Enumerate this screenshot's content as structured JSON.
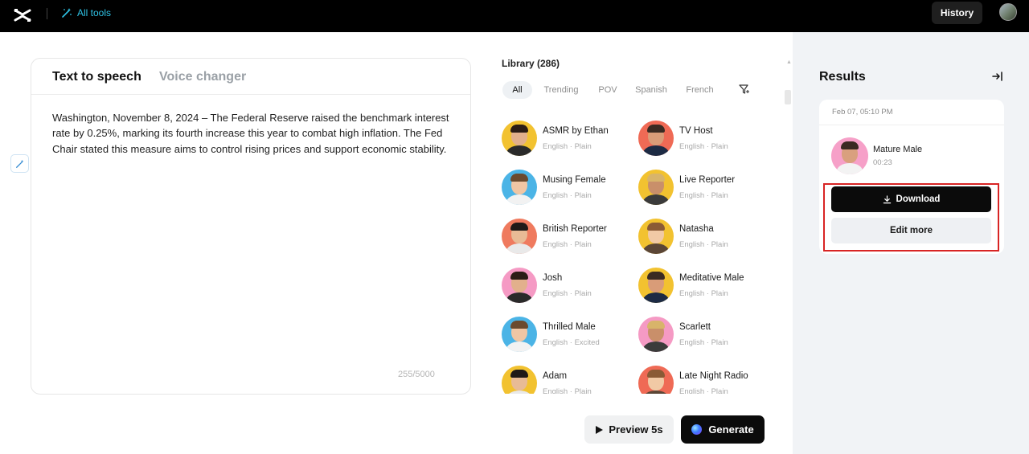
{
  "header": {
    "all_tools_label": "All tools",
    "history_label": "History",
    "icons": [
      "capcut-logo-icon",
      "magic-wand-icon",
      "user-avatar"
    ]
  },
  "editor": {
    "tabs": [
      {
        "label": "Text to speech",
        "active": true
      },
      {
        "label": "Voice changer",
        "active": false
      }
    ],
    "text": "Washington, November 8, 2024 – The Federal Reserve raised the benchmark interest rate by 0.25%, marking its fourth increase this year to combat high inflation. The Fed Chair stated this measure aims to control rising prices and support economic stability.",
    "char_count": "255/5000"
  },
  "library": {
    "title": "Library (286)",
    "filters": [
      {
        "label": "All",
        "active": true
      },
      {
        "label": "Trending",
        "active": false
      },
      {
        "label": "POV",
        "active": false
      },
      {
        "label": "Spanish",
        "active": false
      },
      {
        "label": "French",
        "active": false
      }
    ],
    "voices": [
      {
        "name": "ASMR by Ethan",
        "meta": "English · Plain",
        "bg": "#f2c230"
      },
      {
        "name": "TV Host",
        "meta": "English · Plain",
        "bg": "#ef6a55"
      },
      {
        "name": "Musing Female",
        "meta": "English · Plain",
        "bg": "#4bb4e6"
      },
      {
        "name": "Live Reporter",
        "meta": "English · Plain",
        "bg": "#f2c230"
      },
      {
        "name": "British Reporter",
        "meta": "English · Plain",
        "bg": "#ef7a5e"
      },
      {
        "name": "Natasha",
        "meta": "English · Plain",
        "bg": "#f2c230"
      },
      {
        "name": "Josh",
        "meta": "English · Plain",
        "bg": "#f59ac4"
      },
      {
        "name": "Meditative Male",
        "meta": "English · Plain",
        "bg": "#f2c230"
      },
      {
        "name": "Thrilled Male",
        "meta": "English · Excited",
        "bg": "#4bb4e6"
      },
      {
        "name": "Scarlett",
        "meta": "English · Plain",
        "bg": "#f59ac4"
      },
      {
        "name": "Adam",
        "meta": "English · Plain",
        "bg": "#f2c230"
      },
      {
        "name": "Late Night Radio",
        "meta": "English · Plain",
        "bg": "#ef6a55"
      }
    ]
  },
  "actions": {
    "preview_label": "Preview 5s",
    "generate_label": "Generate"
  },
  "results": {
    "title": "Results",
    "items": [
      {
        "date": "Feb 07, 05:10 PM",
        "voice_name": "Mature Male",
        "duration": "00:23",
        "download_label": "Download",
        "edit_more_label": "Edit more"
      }
    ]
  },
  "colors": {
    "accent_cyan": "#2fc3e6",
    "highlight_red": "#d82424",
    "topbar_bg": "#000000",
    "results_bg": "#f1f3f6"
  }
}
